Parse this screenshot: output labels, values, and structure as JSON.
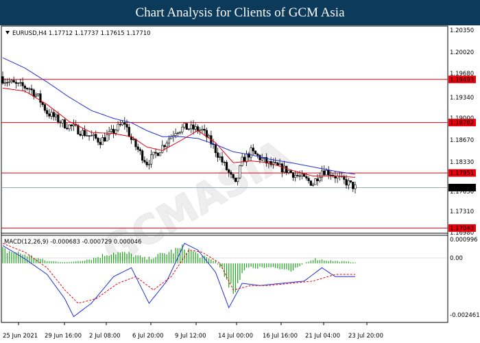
{
  "header": {
    "title": "Chart Analysis for Clients of GCM Asia"
  },
  "colors": {
    "header_bg": "#0b3a5b",
    "ma_fast": "#e8000b",
    "ma_slow": "#1f2fd6",
    "level_line": "#e8000b",
    "current_line": "#9aa6b2",
    "current_tag": "#000000",
    "macd_hist": "#1aa31a",
    "macd_line": "#1f2fd6",
    "signal_line": "#e8000b"
  },
  "chart_data": [
    {
      "type": "candlestick",
      "symbol_info": "EURUSD,H4  1.17712 1.17737 1.17615 1.17710",
      "ylim": [
        1.1698,
        1.2035
      ],
      "y_ticks": [
        "1.20350",
        "1.20020",
        "1.19680",
        "1.19340",
        "1.19000",
        "1.18670",
        "1.18330",
        "1.17650",
        "1.17310",
        "1.16980"
      ],
      "x_ticks": [
        "25 Jun 2021",
        "29 Jun 16:00",
        "2 Jul 08:00",
        "6 Jul 20:00",
        "9 Jul 12:00",
        "14 Jul 00:00",
        "16 Jul 16:00",
        "21 Jul 04:00",
        "23 Jul 20:00"
      ],
      "levels": [
        {
          "value": 1.19493,
          "label": "1.19493"
        },
        {
          "value": 1.18782,
          "label": "1.18782"
        },
        {
          "value": 1.17951,
          "label": "1.17951"
        },
        {
          "value": 1.17043,
          "label": "1.17043"
        }
      ],
      "current_price": {
        "value": 1.1771,
        "label": "1.17710"
      },
      "close_path": [
        [
          0,
          1.195
        ],
        [
          6,
          1.194
        ],
        [
          12,
          1.1935
        ],
        [
          16,
          1.192
        ],
        [
          20,
          1.1895
        ],
        [
          24,
          1.1885
        ],
        [
          28,
          1.1875
        ],
        [
          32,
          1.187
        ],
        [
          36,
          1.1862
        ],
        [
          40,
          1.1855
        ],
        [
          44,
          1.1848
        ],
        [
          48,
          1.1858
        ],
        [
          52,
          1.187
        ],
        [
          55,
          1.1878
        ],
        [
          58,
          1.185
        ],
        [
          62,
          1.1828
        ],
        [
          65,
          1.1812
        ],
        [
          70,
          1.183
        ],
        [
          74,
          1.1848
        ],
        [
          78,
          1.1865
        ],
        [
          82,
          1.187
        ],
        [
          86,
          1.1868
        ],
        [
          90,
          1.1865
        ],
        [
          94,
          1.1845
        ],
        [
          98,
          1.182
        ],
        [
          102,
          1.1795
        ],
        [
          105,
          1.1775
        ],
        [
          108,
          1.1815
        ],
        [
          112,
          1.183
        ],
        [
          116,
          1.182
        ],
        [
          120,
          1.181
        ],
        [
          124,
          1.1805
        ],
        [
          128,
          1.18
        ],
        [
          132,
          1.1792
        ],
        [
          136,
          1.1785
        ],
        [
          140,
          1.1778
        ],
        [
          144,
          1.18
        ],
        [
          148,
          1.1795
        ],
        [
          152,
          1.1785
        ],
        [
          156,
          1.1778
        ],
        [
          159,
          1.1771
        ]
      ],
      "ma_fast": [
        [
          0,
          1.1935
        ],
        [
          10,
          1.193
        ],
        [
          20,
          1.1908
        ],
        [
          30,
          1.188
        ],
        [
          40,
          1.1862
        ],
        [
          50,
          1.186
        ],
        [
          58,
          1.1855
        ],
        [
          65,
          1.1838
        ],
        [
          72,
          1.1832
        ],
        [
          80,
          1.1848
        ],
        [
          88,
          1.1865
        ],
        [
          96,
          1.1845
        ],
        [
          104,
          1.1812
        ],
        [
          112,
          1.1815
        ],
        [
          120,
          1.1812
        ],
        [
          130,
          1.18
        ],
        [
          140,
          1.179
        ],
        [
          150,
          1.179
        ],
        [
          159,
          1.1788
        ]
      ],
      "ma_slow": [
        [
          0,
          1.1985
        ],
        [
          10,
          1.1968
        ],
        [
          20,
          1.1945
        ],
        [
          30,
          1.192
        ],
        [
          40,
          1.1898
        ],
        [
          50,
          1.1885
        ],
        [
          58,
          1.1878
        ],
        [
          65,
          1.1865
        ],
        [
          72,
          1.1855
        ],
        [
          80,
          1.1855
        ],
        [
          88,
          1.1852
        ],
        [
          96,
          1.1842
        ],
        [
          104,
          1.183
        ],
        [
          112,
          1.1825
        ],
        [
          120,
          1.1818
        ],
        [
          130,
          1.1812
        ],
        [
          140,
          1.1805
        ],
        [
          150,
          1.1798
        ],
        [
          159,
          1.1793
        ]
      ]
    },
    {
      "type": "histogram",
      "label": "MACD(12,26,9) -0.000683 -0.000729 0.000046",
      "ylim": [
        -0.0026,
        0.0012
      ],
      "y_ticks": [
        "0.000996",
        "0.00",
        "-0.002461"
      ],
      "histogram_path": [
        [
          0,
          0.0006
        ],
        [
          10,
          0.0004
        ],
        [
          20,
          0.0001
        ],
        [
          30,
          5e-05
        ],
        [
          40,
          0.0002
        ],
        [
          50,
          0.0005
        ],
        [
          58,
          0.0004
        ],
        [
          65,
          0.0002
        ],
        [
          75,
          0.0005
        ],
        [
          82,
          0.0007
        ],
        [
          90,
          0.0003
        ],
        [
          96,
          0.0001
        ],
        [
          100,
          -0.0005
        ],
        [
          104,
          -0.0012
        ],
        [
          110,
          -0.0002
        ],
        [
          120,
          -0.0002
        ],
        [
          130,
          -0.0003
        ],
        [
          140,
          0.0002
        ],
        [
          150,
          0.0001
        ],
        [
          159,
          5e-05
        ]
      ],
      "macd_line": [
        [
          0,
          0.0008
        ],
        [
          10,
          0.0002
        ],
        [
          20,
          -0.0005
        ],
        [
          28,
          -0.0016
        ],
        [
          32,
          -0.0024
        ],
        [
          40,
          -0.0018
        ],
        [
          50,
          -0.0006
        ],
        [
          58,
          -0.0002
        ],
        [
          66,
          -0.0018
        ],
        [
          74,
          -0.0008
        ],
        [
          82,
          0.0009
        ],
        [
          88,
          0.0006
        ],
        [
          96,
          -0.0004
        ],
        [
          102,
          -0.002
        ],
        [
          108,
          -0.0009
        ],
        [
          116,
          -0.001
        ],
        [
          126,
          -0.0009
        ],
        [
          136,
          -0.0008
        ],
        [
          144,
          -0.0002
        ],
        [
          150,
          -0.0006
        ],
        [
          159,
          -0.0006
        ]
      ],
      "signal_line": [
        [
          0,
          0.0009
        ],
        [
          10,
          0.0005
        ],
        [
          20,
          -0.0002
        ],
        [
          28,
          -0.0012
        ],
        [
          34,
          -0.0018
        ],
        [
          42,
          -0.0016
        ],
        [
          52,
          -0.0009
        ],
        [
          60,
          -0.0006
        ],
        [
          68,
          -0.0012
        ],
        [
          76,
          -0.0006
        ],
        [
          84,
          0.0006
        ],
        [
          90,
          0.0005
        ],
        [
          98,
          0.0
        ],
        [
          104,
          -0.0012
        ],
        [
          112,
          -0.001
        ],
        [
          120,
          -0.001
        ],
        [
          130,
          -0.0009
        ],
        [
          140,
          -0.0008
        ],
        [
          150,
          -0.0005
        ],
        [
          159,
          -0.0005
        ]
      ]
    }
  ]
}
